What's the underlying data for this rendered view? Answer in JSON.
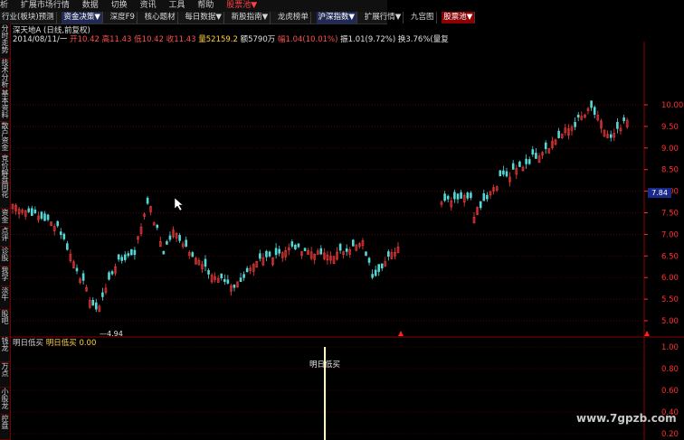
{
  "menu": {
    "items": [
      "析",
      "扩展市场行情",
      "数据",
      "切换",
      "资讯",
      "工具",
      "帮助"
    ],
    "highlight": "股票池",
    "highlight_suffix": "▼"
  },
  "toolbar": {
    "items": [
      "行业(板块)预测",
      "资金决策▼",
      "深度F9",
      "核心题材",
      "每日数据▼",
      "新股指南▼",
      "龙虎榜单",
      "沪深指数▼",
      "扩展行情▼",
      "九宫图",
      "股票池▼"
    ]
  },
  "sidebar": {
    "items": [
      "分时走势",
      "技术分析",
      "基本资料",
      "散户资金",
      "竞价解盘",
      "同花",
      "资金",
      "点评",
      "诊股",
      "我学",
      "淡牛",
      "股吧",
      "钱龙",
      "万点",
      "小股龙",
      "控盘"
    ]
  },
  "stock": {
    "title": "深天地A (日线,前复权)",
    "date": "2014/08/11/一",
    "open": "开10.42",
    "high": "高11.43",
    "low": "低10.42",
    "close": "收11.43",
    "volume": "量52159.2",
    "amount": "额5790万",
    "change": "幅1.04(10.01%)",
    "amplitude": "振1.01(9.72%)",
    "turnover": "换3.76%(量复"
  },
  "price_axis": {
    "labels": [
      "10.00",
      "9.50",
      "9.00",
      "8.50",
      "8.00",
      "7.50",
      "7.00",
      "6.50",
      "6.00",
      "5.50",
      "5.00"
    ],
    "current": "7.84",
    "low_marker": "4.94"
  },
  "indicator": {
    "name": "明日低买",
    "label": "明日低买",
    "value": "0.00",
    "axis_labels": [
      "1.00",
      "0.80",
      "0.60",
      "0.40",
      "0.20"
    ],
    "annotation": "明日低买"
  },
  "watermark": "www.7gpzb.com",
  "colors": {
    "up": "#ff3c3c",
    "down": "#54d8d8",
    "grid": "#6a0000",
    "signal": "#ffffc8"
  }
}
